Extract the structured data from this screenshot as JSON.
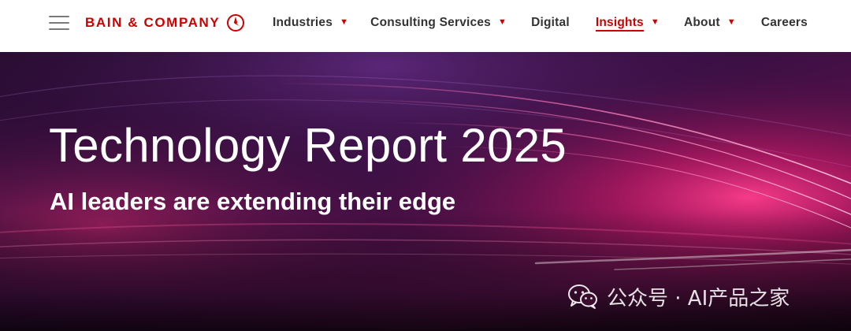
{
  "header": {
    "brand": "BAIN & COMPANY",
    "brand_color": "#cc0000",
    "menu_icon": "hamburger-menu-icon",
    "nav": [
      {
        "label": "Industries",
        "has_dropdown": true,
        "active": false
      },
      {
        "label": "Consulting Services",
        "has_dropdown": true,
        "active": false
      },
      {
        "label": "Digital",
        "has_dropdown": false,
        "active": false
      },
      {
        "label": "Insights",
        "has_dropdown": true,
        "active": true
      },
      {
        "label": "About",
        "has_dropdown": true,
        "active": false
      },
      {
        "label": "Careers",
        "has_dropdown": false,
        "active": false
      }
    ],
    "dropdown_glyph": "▼"
  },
  "hero": {
    "title": "Technology Report 2025",
    "subtitle": "AI leaders are extending their edge",
    "background": "purple-magenta light streaks"
  },
  "watermark": {
    "text": "公众号 · AI产品之家",
    "icon": "wechat-icon"
  }
}
